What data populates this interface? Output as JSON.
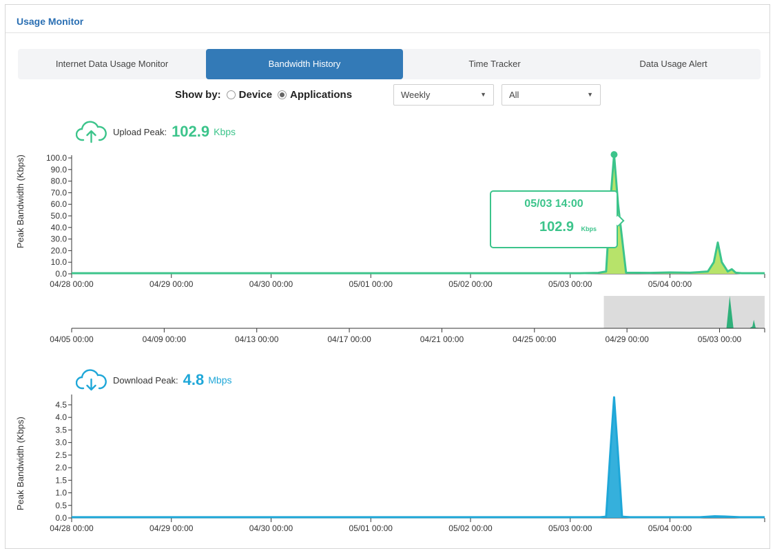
{
  "header": {
    "title": "Usage Monitor"
  },
  "tabs": [
    {
      "label": "Internet Data Usage Monitor"
    },
    {
      "label": "Bandwidth History"
    },
    {
      "label": "Time Tracker"
    },
    {
      "label": "Data Usage Alert"
    }
  ],
  "controls": {
    "show_by_label": "Show by:",
    "device_label": "Device",
    "applications_label": "Applications",
    "selected_mode": "Applications",
    "period_select": "Weekly",
    "filter_select": "All"
  },
  "upload": {
    "label": "Upload Peak:",
    "value": "102.9",
    "unit": "Kbps",
    "axis_label": "Peak Bandwidth (Kbps)",
    "tooltip_time": "05/03 14:00",
    "tooltip_value": "102.9",
    "tooltip_unit": "Kbps"
  },
  "download": {
    "label": "Download Peak:",
    "value": "4.8",
    "unit": "Mbps",
    "axis_label": "Peak Bandwidth (Kbps)"
  },
  "colors": {
    "accent": "#337ab7",
    "upload": "#3cc48b",
    "upload_fill": "#b7e36a",
    "download": "#1fa7d8",
    "brush": "#dcdcdc"
  },
  "chart_data": [
    {
      "type": "area",
      "ylabel": "Peak Bandwidth (Kbps)",
      "ylim": [
        0,
        100
      ],
      "yticks": [
        "0.0",
        "10.0",
        "20.0",
        "30.0",
        "40.0",
        "50.0",
        "60.0",
        "70.0",
        "80.0",
        "90.0",
        "100.0"
      ],
      "xticks": [
        "04/28 00:00",
        "04/29 00:00",
        "04/30 00:00",
        "05/01 00:00",
        "05/02 00:00",
        "05/03 00:00",
        "05/04 00:00"
      ],
      "xlim_days": [
        0,
        6.95
      ],
      "x_days": [
        0,
        5.1,
        5.28,
        5.36,
        5.4,
        5.44,
        5.48,
        5.56,
        5.8,
        6.0,
        6.2,
        6.38,
        6.44,
        6.48,
        6.52,
        6.58,
        6.62,
        6.66,
        6.72,
        6.95
      ],
      "y": [
        0.5,
        0.5,
        0.8,
        2,
        60,
        102.9,
        60,
        1,
        0.8,
        1.2,
        1,
        2,
        10,
        27,
        10,
        2,
        4,
        1,
        0.5,
        0.5
      ],
      "marker": {
        "x_day": 5.44,
        "value": 102.9
      },
      "grid": false
    },
    {
      "type": "area",
      "title": "overview",
      "xticks": [
        "04/05 00:00",
        "04/09 00:00",
        "04/13 00:00",
        "04/17 00:00",
        "04/21 00:00",
        "04/25 00:00",
        "04/29 00:00",
        "05/03 00:00"
      ],
      "xlim_days": [
        0,
        29.95
      ],
      "x_days": [
        0,
        28.2,
        28.3,
        28.44,
        28.6,
        29.3,
        29.42,
        29.48,
        29.56,
        29.95
      ],
      "y": [
        0,
        0,
        1,
        102.9,
        1,
        0.5,
        6,
        27,
        2,
        0
      ],
      "selection_days": [
        23,
        29.95
      ]
    },
    {
      "type": "area",
      "ylabel": "Peak Bandwidth (Kbps)",
      "ylim": [
        0,
        4.8
      ],
      "yticks": [
        "0.0",
        "0.5",
        "1.0",
        "1.5",
        "2.0",
        "2.5",
        "3.0",
        "3.5",
        "4.0",
        "4.5"
      ],
      "xticks": [
        "04/28 00:00",
        "04/29 00:00",
        "04/30 00:00",
        "05/01 00:00",
        "05/02 00:00",
        "05/03 00:00",
        "05/04 00:00"
      ],
      "xlim_days": [
        0,
        6.95
      ],
      "x_days": [
        0,
        5.3,
        5.36,
        5.4,
        5.44,
        5.48,
        5.52,
        5.6,
        6.3,
        6.45,
        6.55,
        6.7,
        6.95
      ],
      "y": [
        0.03,
        0.03,
        0.05,
        2.5,
        4.8,
        2.5,
        0.05,
        0.03,
        0.03,
        0.07,
        0.06,
        0.03,
        0.03
      ],
      "grid": false
    }
  ]
}
